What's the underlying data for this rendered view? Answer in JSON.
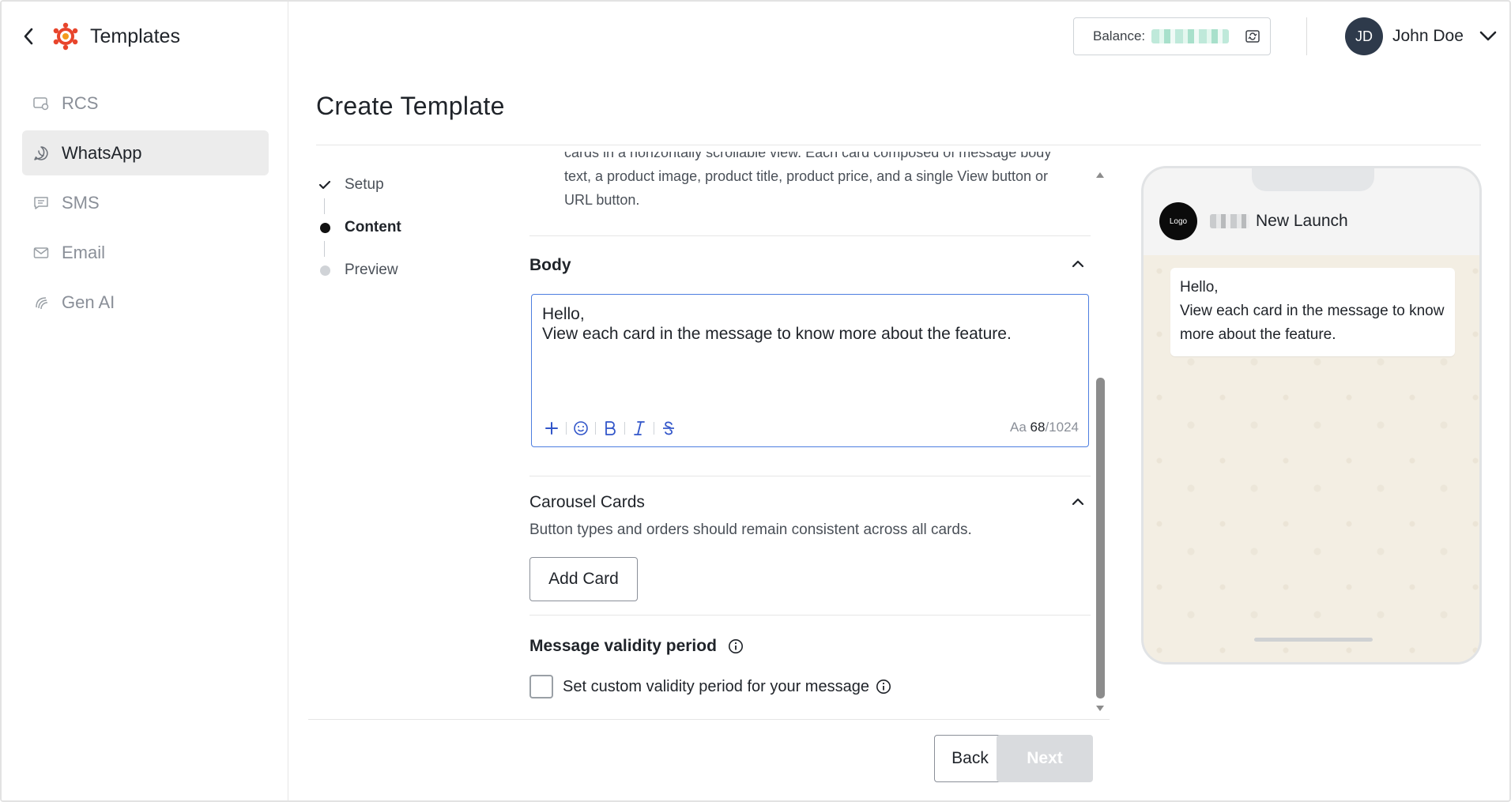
{
  "sidebar": {
    "title": "Templates",
    "items": [
      {
        "label": "RCS",
        "icon": "rcs-icon",
        "active": false
      },
      {
        "label": "WhatsApp",
        "icon": "whatsapp-icon",
        "active": true
      },
      {
        "label": "SMS",
        "icon": "sms-icon",
        "active": false
      },
      {
        "label": "Email",
        "icon": "email-icon",
        "active": false
      },
      {
        "label": "Gen AI",
        "icon": "gen-ai-icon",
        "active": false
      }
    ]
  },
  "topbar": {
    "balance_label": "Balance:",
    "user_initials": "JD",
    "user_name": "John Doe"
  },
  "page": {
    "title": "Create Template"
  },
  "stepper": [
    {
      "label": "Setup",
      "state": "done"
    },
    {
      "label": "Content",
      "state": "current"
    },
    {
      "label": "Preview",
      "state": "pending"
    }
  ],
  "form": {
    "carousel_description_visible": "cards in a horizontally scrollable view. Each card composed of message body text, a product image, product title, product price, and a single View button or URL button.",
    "body": {
      "title": "Body",
      "text": "Hello,\nView each card in the message to know more about the feature.",
      "counter_prefix": "Aa",
      "char_count": "68",
      "char_limit": "/1024"
    },
    "carousel": {
      "title": "Carousel Cards",
      "description": "Button types and orders should remain consistent across all cards.",
      "add_button": "Add Card"
    },
    "validity": {
      "title": "Message validity period",
      "checkbox_label": "Set custom validity period for your message",
      "checked": false
    }
  },
  "footer": {
    "back_label": "Back",
    "next_label": "Next"
  },
  "preview": {
    "logo_text": "Logo",
    "sender_name": "New Launch",
    "message": "Hello,\nView each card in the message to know more about the feature."
  },
  "colors": {
    "accent_blue": "#4d7ee0",
    "toolbar_icon": "#3155c9",
    "avatar_bg": "#2e3a4b",
    "active_nav_bg": "#ececec",
    "disabled_button_bg": "#d9dbde"
  }
}
